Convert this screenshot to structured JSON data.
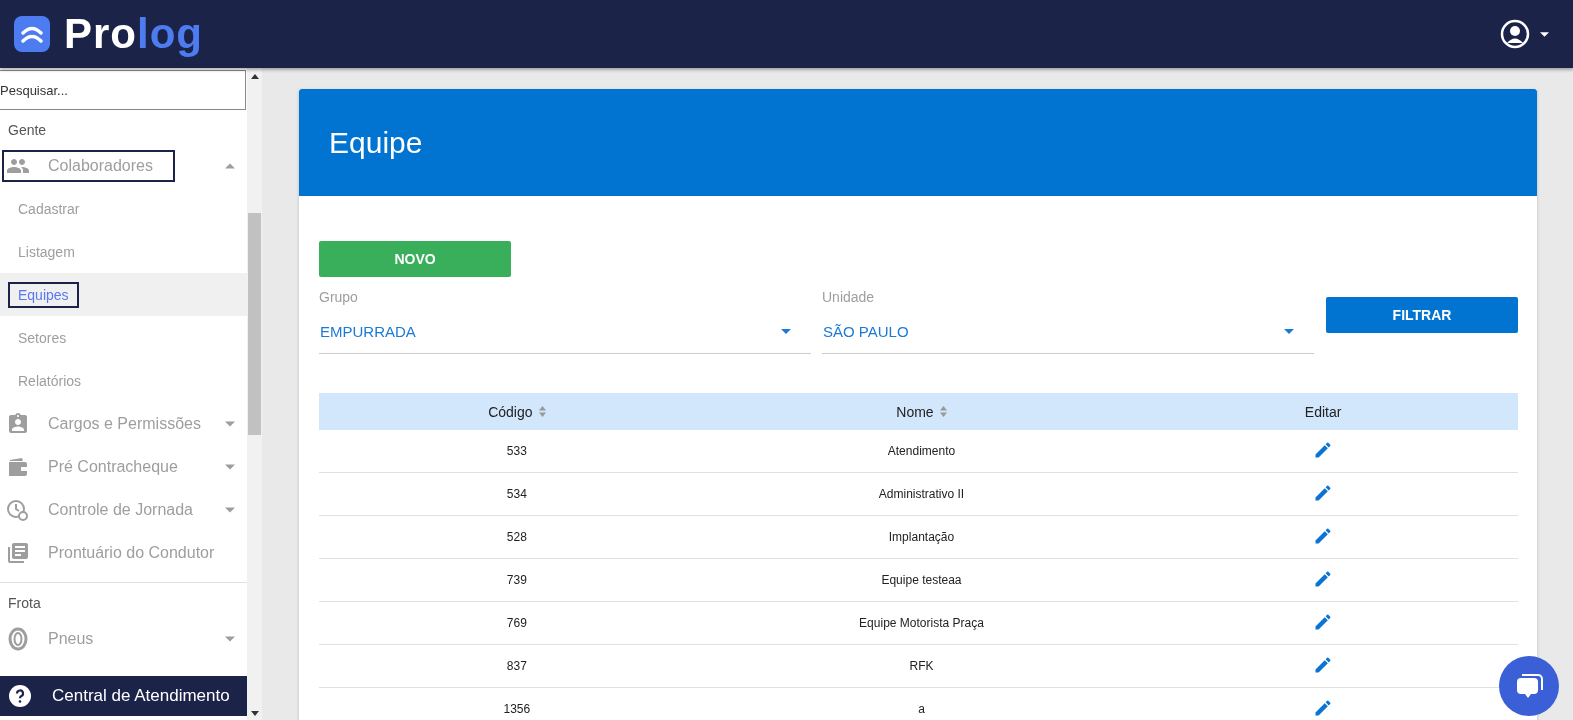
{
  "logo": {
    "parts": [
      "Pro",
      "log"
    ]
  },
  "sidebar": {
    "search": {
      "placeholder": "Pesquisar..."
    },
    "sections": [
      {
        "title": "Gente",
        "items": [
          {
            "kind": "group",
            "label": "Colaboradores",
            "expanded": true,
            "outlined": true,
            "children": [
              {
                "label": "Cadastrar",
                "selected": false,
                "outlined": false
              },
              {
                "label": "Listagem",
                "selected": false,
                "outlined": false
              },
              {
                "label": "Equipes",
                "selected": true,
                "outlined": true
              },
              {
                "label": "Setores",
                "selected": false,
                "outlined": false
              },
              {
                "label": "Relatórios",
                "selected": false,
                "outlined": false
              }
            ]
          },
          {
            "kind": "group",
            "label": "Cargos e Permissões",
            "expanded": false,
            "outlined": false
          },
          {
            "kind": "group",
            "label": "Pré Contracheque",
            "expanded": false,
            "outlined": false
          },
          {
            "kind": "group",
            "label": "Controle de Jornada",
            "expanded": false,
            "outlined": false
          },
          {
            "kind": "link",
            "label": "Prontuário do Condutor",
            "outlined": false
          }
        ]
      },
      {
        "title": "Frota",
        "items": [
          {
            "kind": "group",
            "label": "Pneus",
            "expanded": false,
            "outlined": false
          }
        ]
      }
    ],
    "help": "Central de Atendimento"
  },
  "page": {
    "title": "Equipe",
    "new_button": "NOVO",
    "filters": [
      {
        "label": "Grupo",
        "value": "EMPURRADA"
      },
      {
        "label": "Unidade",
        "value": "SÃO PAULO"
      }
    ],
    "filter_button": "FILTRAR"
  },
  "table": {
    "columns": [
      {
        "label": "Código",
        "sortable": true
      },
      {
        "label": "Nome",
        "sortable": true
      },
      {
        "label": "Editar",
        "sortable": false
      }
    ],
    "rows": [
      {
        "code": "533",
        "name": "Atendimento"
      },
      {
        "code": "534",
        "name": "Administrativo II"
      },
      {
        "code": "528",
        "name": "Implantação"
      },
      {
        "code": "739",
        "name": "Equipe testeaa"
      },
      {
        "code": "769",
        "name": "Equipe Motorista Praça"
      },
      {
        "code": "837",
        "name": "RFK"
      },
      {
        "code": "1356",
        "name": "a"
      }
    ]
  }
}
